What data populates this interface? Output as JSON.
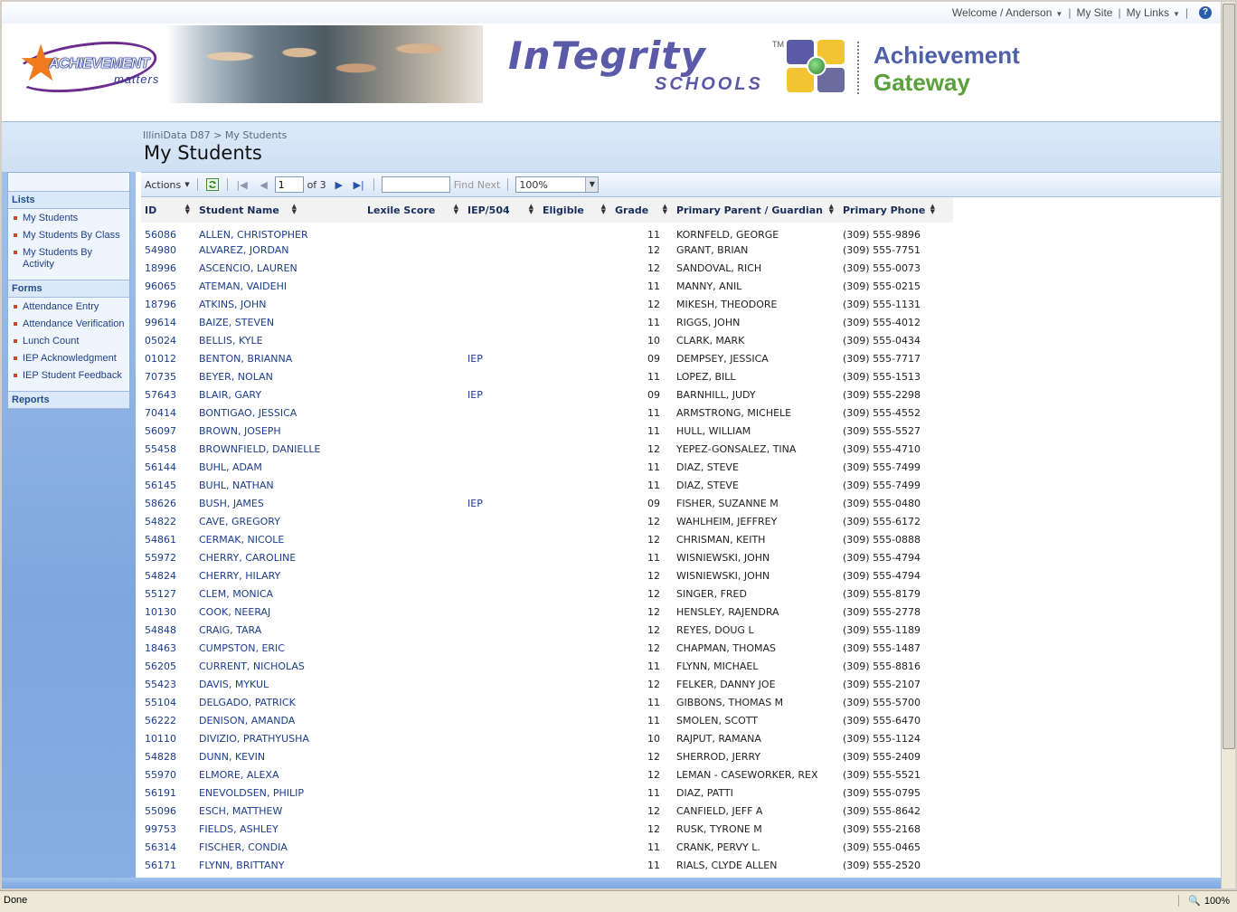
{
  "topbar": {
    "welcome": "Welcome / Anderson",
    "my_site": "My Site",
    "my_links": "My Links",
    "help_glyph": "?"
  },
  "banner": {
    "ach_line1": "ACHIEVEMENT",
    "ach_line2": "matters",
    "integrity": "InTegrity",
    "tm": "TM",
    "schools": "SCHOOLS",
    "gateway_line1": "Achievement",
    "gateway_line2": "Gateway",
    "square_colors": [
      "#5b5aa6",
      "#f3c431",
      "#f3c431",
      "#6b6b9e"
    ]
  },
  "breadcrumb": "IlliniData D87 > My Students",
  "page_title": "My Students",
  "nav": {
    "lists_header": "Lists",
    "lists": [
      "My Students",
      "My Students By Class",
      "My Students By Activity"
    ],
    "forms_header": "Forms",
    "forms": [
      "Attendance Entry",
      "Attendance Verification",
      "Lunch Count",
      "IEP Acknowledgment",
      "IEP Student Feedback"
    ],
    "reports_header": "Reports"
  },
  "toolbar": {
    "actions": "Actions",
    "page_value": "1",
    "of_pages": "of 3",
    "find_value": "",
    "find_next": "Find Next",
    "zoom": "100%"
  },
  "table": {
    "headers": {
      "id": "ID",
      "name": "Student Name",
      "lexile": "Lexile Score",
      "iep": "IEP/504",
      "eligible": "Eligible",
      "grade": "Grade",
      "parent": "Primary Parent / Guardian",
      "phone": "Primary Phone"
    },
    "rows": [
      [
        "56086",
        "ALLEN, CHRISTOPHER",
        "",
        "",
        "",
        "11",
        "KORNFELD, GEORGE",
        "(309) 555-9896"
      ],
      [
        "54980",
        "ALVAREZ, JORDAN",
        "",
        "",
        "",
        "12",
        "GRANT, BRIAN",
        "(309) 555-7751"
      ],
      [
        "18996",
        "ASCENCIO, LAUREN",
        "",
        "",
        "",
        "12",
        "SANDOVAL, RICH",
        "(309) 555-0073"
      ],
      [
        "96065",
        "ATEMAN, VAIDEHI",
        "",
        "",
        "",
        "11",
        "MANNY, ANIL",
        "(309) 555-0215"
      ],
      [
        "18796",
        "ATKINS, JOHN",
        "",
        "",
        "",
        "12",
        "MIKESH, THEODORE",
        "(309) 555-1131"
      ],
      [
        "99614",
        "BAIZE, STEVEN",
        "",
        "",
        "",
        "11",
        "RIGGS, JOHN",
        "(309) 555-4012"
      ],
      [
        "05024",
        "BELLIS, KYLE",
        "",
        "",
        "",
        "10",
        "CLARK, MARK",
        "(309) 555-0434"
      ],
      [
        "01012",
        "BENTON, BRIANNA",
        "",
        "IEP",
        "",
        "09",
        "DEMPSEY, JESSICA",
        "(309) 555-7717"
      ],
      [
        "70735",
        "BEYER, NOLAN",
        "",
        "",
        "",
        "11",
        "LOPEZ, BILL",
        "(309) 555-1513"
      ],
      [
        "57643",
        "BLAIR, GARY",
        "",
        "IEP",
        "",
        "09",
        "BARNHILL, JUDY",
        "(309) 555-2298"
      ],
      [
        "70414",
        "BONTIGAO, JESSICA",
        "",
        "",
        "",
        "11",
        "ARMSTRONG, MICHELE",
        "(309) 555-4552"
      ],
      [
        "56097",
        "BROWN, JOSEPH",
        "",
        "",
        "",
        "11",
        "HULL, WILLIAM",
        "(309) 555-5527"
      ],
      [
        "55458",
        "BROWNFIELD, DANIELLE",
        "",
        "",
        "",
        "12",
        "YEPEZ-GONSALEZ, TINA",
        "(309) 555-4710"
      ],
      [
        "56144",
        "BUHL, ADAM",
        "",
        "",
        "",
        "11",
        "DIAZ, STEVE",
        "(309) 555-7499"
      ],
      [
        "56145",
        "BUHL, NATHAN",
        "",
        "",
        "",
        "11",
        "DIAZ, STEVE",
        "(309) 555-7499"
      ],
      [
        "58626",
        "BUSH, JAMES",
        "",
        "IEP",
        "",
        "09",
        "FISHER, SUZANNE M",
        "(309) 555-0480"
      ],
      [
        "54822",
        "CAVE, GREGORY",
        "",
        "",
        "",
        "12",
        "WAHLHEIM, JEFFREY",
        "(309) 555-6172"
      ],
      [
        "54861",
        "CERMAK, NICOLE",
        "",
        "",
        "",
        "12",
        "CHRISMAN, KEITH",
        "(309) 555-0888"
      ],
      [
        "55972",
        "CHERRY, CAROLINE",
        "",
        "",
        "",
        "11",
        "WISNIEWSKI, JOHN",
        "(309) 555-4794"
      ],
      [
        "54824",
        "CHERRY, HILARY",
        "",
        "",
        "",
        "12",
        "WISNIEWSKI, JOHN",
        "(309) 555-4794"
      ],
      [
        "55127",
        "CLEM, MONICA",
        "",
        "",
        "",
        "12",
        "SINGER, FRED",
        "(309) 555-8179"
      ],
      [
        "10130",
        "COOK, NEERAJ",
        "",
        "",
        "",
        "12",
        "HENSLEY, RAJENDRA",
        "(309) 555-2778"
      ],
      [
        "54848",
        "CRAIG, TARA",
        "",
        "",
        "",
        "12",
        "REYES, DOUG L",
        "(309) 555-1189"
      ],
      [
        "18463",
        "CUMPSTON, ERIC",
        "",
        "",
        "",
        "12",
        "CHAPMAN, THOMAS",
        "(309) 555-1487"
      ],
      [
        "56205",
        "CURRENT, NICHOLAS",
        "",
        "",
        "",
        "11",
        "FLYNN, MICHAEL",
        "(309) 555-8816"
      ],
      [
        "55423",
        "DAVIS, MYKUL",
        "",
        "",
        "",
        "12",
        "FELKER, DANNY JOE",
        "(309) 555-2107"
      ],
      [
        "55104",
        "DELGADO, PATRICK",
        "",
        "",
        "",
        "11",
        "GIBBONS, THOMAS M",
        "(309) 555-5700"
      ],
      [
        "56222",
        "DENISON, AMANDA",
        "",
        "",
        "",
        "11",
        "SMOLEN, SCOTT",
        "(309) 555-6470"
      ],
      [
        "10110",
        "DIVIZIO, PRATHYUSHA",
        "",
        "",
        "",
        "10",
        "RAJPUT, RAMANA",
        "(309) 555-1124"
      ],
      [
        "54828",
        "DUNN, KEVIN",
        "",
        "",
        "",
        "12",
        "SHERROD, JERRY",
        "(309) 555-2409"
      ],
      [
        "55970",
        "ELMORE, ALEXA",
        "",
        "",
        "",
        "12",
        "LEMAN - CASEWORKER, REX",
        "(309) 555-5521"
      ],
      [
        "56191",
        "ENEVOLDSEN, PHILIP",
        "",
        "",
        "",
        "11",
        "DIAZ, PATTI",
        "(309) 555-0795"
      ],
      [
        "55096",
        "ESCH, MATTHEW",
        "",
        "",
        "",
        "12",
        "CANFIELD, JEFF A",
        "(309) 555-8642"
      ],
      [
        "99753",
        "FIELDS, ASHLEY",
        "",
        "",
        "",
        "12",
        "RUSK, TYRONE M",
        "(309) 555-2168"
      ],
      [
        "56314",
        "FISCHER, CONDIA",
        "",
        "",
        "",
        "11",
        "CRANK, PERVY L.",
        "(309) 555-0465"
      ],
      [
        "56171",
        "FLYNN, BRITTANY",
        "",
        "",
        "",
        "11",
        "RIALS, CLYDE ALLEN",
        "(309) 555-2520"
      ]
    ]
  },
  "statusbar": {
    "status": "Done",
    "zoom": "100%"
  }
}
